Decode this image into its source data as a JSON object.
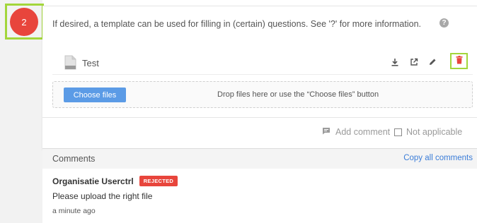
{
  "step": {
    "number": "2"
  },
  "question": {
    "info_text": "If desired, a template can be used for filling in (certain) questions. See '?' for more information.",
    "help_icon_label": "?"
  },
  "file": {
    "name": "Test",
    "icon": "file-icon",
    "actions": [
      "download-icon",
      "open-external-icon",
      "edit-icon",
      "delete-icon"
    ]
  },
  "upload": {
    "button_label": "Choose files",
    "drop_text": "Drop files here or use the “Choose files” button"
  },
  "footer": {
    "add_comment_label": "Add comment",
    "not_applicable_label": "Not applicable",
    "not_applicable_checked": false
  },
  "comments": {
    "title": "Comments",
    "copy_all_label": "Copy all comments",
    "items": [
      {
        "author": "Organisatie Userctrl",
        "status": "REJECTED",
        "text": "Please upload the right file",
        "time": "a minute ago"
      }
    ]
  },
  "colors": {
    "badge_red": "#e8453c",
    "highlight_green": "#a3d63b",
    "button_blue": "#5b9be6",
    "link_blue": "#3b7dd8"
  }
}
